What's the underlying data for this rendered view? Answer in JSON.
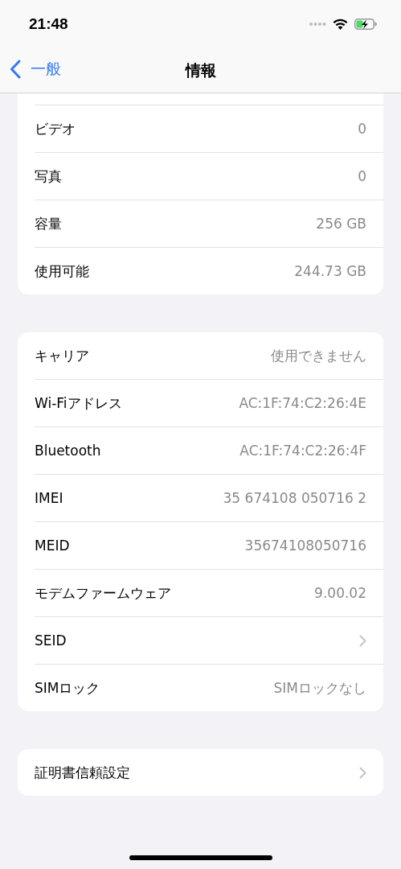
{
  "status_bar": {
    "time": "21:48"
  },
  "nav": {
    "back": "一般",
    "title": "情報"
  },
  "groups": [
    {
      "cut_top": true,
      "rows": [
        {
          "label": "ビデオ",
          "value": "0",
          "kind": "value"
        },
        {
          "label": "写真",
          "value": "0",
          "kind": "value"
        },
        {
          "label": "容量",
          "value": "256 GB",
          "kind": "value"
        },
        {
          "label": "使用可能",
          "value": "244.73 GB",
          "kind": "value"
        }
      ]
    },
    {
      "cut_top": false,
      "rows": [
        {
          "label": "キャリア",
          "value": "使用できません",
          "kind": "value"
        },
        {
          "label": "Wi-Fiアドレス",
          "value": "AC:1F:74:C2:26:4E",
          "kind": "value"
        },
        {
          "label": "Bluetooth",
          "value": "AC:1F:74:C2:26:4F",
          "kind": "value"
        },
        {
          "label": "IMEI",
          "value": "35 674108 050716 2",
          "kind": "value"
        },
        {
          "label": "MEID",
          "value": "35674108050716",
          "kind": "value"
        },
        {
          "label": "モデムファームウェア",
          "value": "9.00.02",
          "kind": "value"
        },
        {
          "label": "SEID",
          "kind": "link"
        },
        {
          "label": "SIMロック",
          "value": "SIMロックなし",
          "kind": "value"
        }
      ]
    },
    {
      "cut_top": false,
      "rows": [
        {
          "label": "証明書信頼設定",
          "kind": "link"
        }
      ]
    }
  ]
}
